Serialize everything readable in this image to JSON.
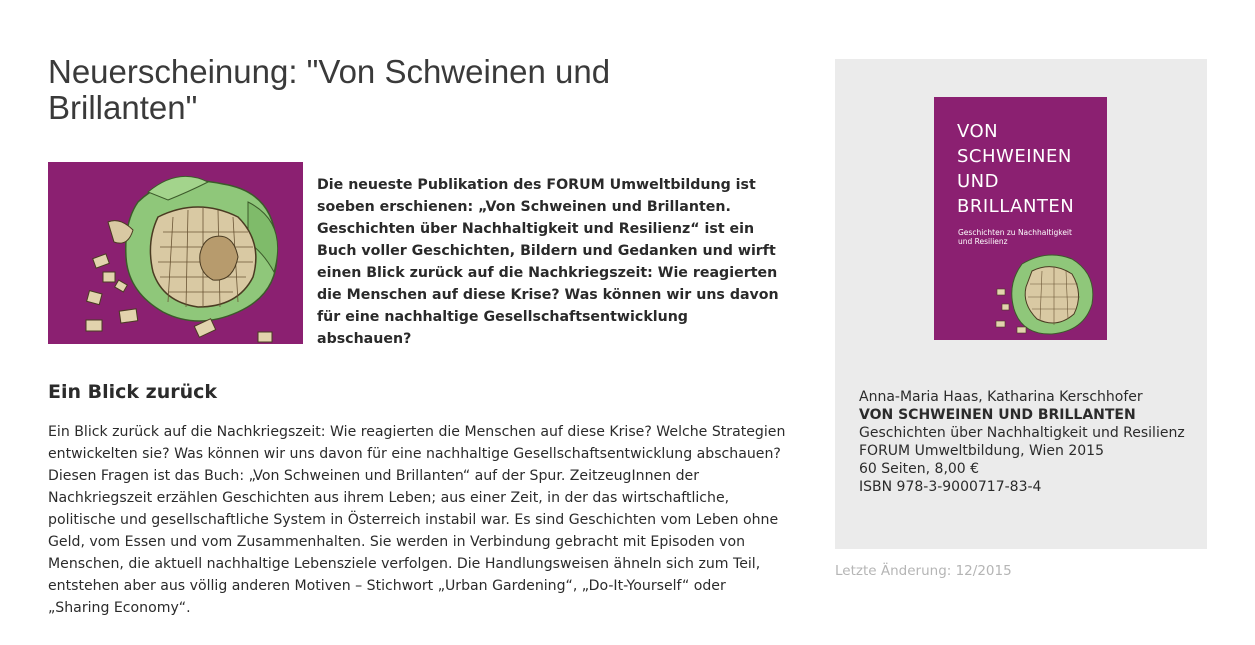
{
  "page": {
    "title": "Neuerscheinung: \"Von Schweinen und Brillanten\""
  },
  "intro": {
    "text": "Die neueste Publikation des FORUM Umweltbildung ist soeben erschienen: „Von Schweinen und Brillanten. Geschichten über Nachhaltigkeit und Resilienz“ ist ein Buch voller Geschichten, Bildern und Gedanken und wirft einen Blick zurück auf die Nachkriegszeit: Wie reagierten die Menschen auf diese Krise? Was können wir uns davon für eine nachhaltige Gesellschaftsentwicklung abschauen?"
  },
  "section": {
    "heading": "Ein Blick zurück",
    "body": "Ein Blick zurück auf die Nachkriegszeit: Wie reagierten die Menschen auf diese Krise? Welche Strategien entwickelten sie? Was können wir uns davon für eine nachhaltige Gesellschaftsentwicklung abschauen? Diesen Fragen ist das Buch: „Von Schweinen und Brillanten“ auf der Spur. ZeitzeugInnen der Nachkriegszeit erzählen Geschichten aus ihrem Leben; aus einer Zeit, in der das wirtschaftliche, politische und gesellschaftliche System in Österreich instabil war. Es sind Geschichten vom Leben ohne Geld, vom Essen und vom Zusammenhalten. Sie werden in Verbindung gebracht mit Episoden von Menschen, die aktuell nachhaltige Lebensziele verfolgen. Die Handlungsweisen ähneln sich zum Teil, entstehen aber aus völlig anderen Motiven – Stichwort „Urban Gardening“, „Do-It-Yourself“ oder „Sharing Economy“."
  },
  "cover": {
    "title_lines": [
      "VON",
      "SCHWEINEN",
      "UND",
      "BRILLANTEN"
    ],
    "subtitle": "Geschichten zu Nachhaltigkeit und Resilienz"
  },
  "book": {
    "authors": "Anna-Maria Haas, Katharina Kerschhofer",
    "title": "VON SCHWEINEN UND BRILLANTEN",
    "subtitle": "Geschichten über Nachhaltigkeit und Resilienz",
    "publisher": "FORUM Umweltbildung, Wien 2015",
    "pages_price": "60 Seiten, 8,00 €",
    "isbn": "ISBN 978-3-9000717-83-4"
  },
  "footer": {
    "last_changed": "Letzte Änderung: 12/2015"
  },
  "colors": {
    "cover_purple": "#8b2071",
    "sidebar_bg": "#ebebeb",
    "muted_text": "#b5b5b5"
  }
}
